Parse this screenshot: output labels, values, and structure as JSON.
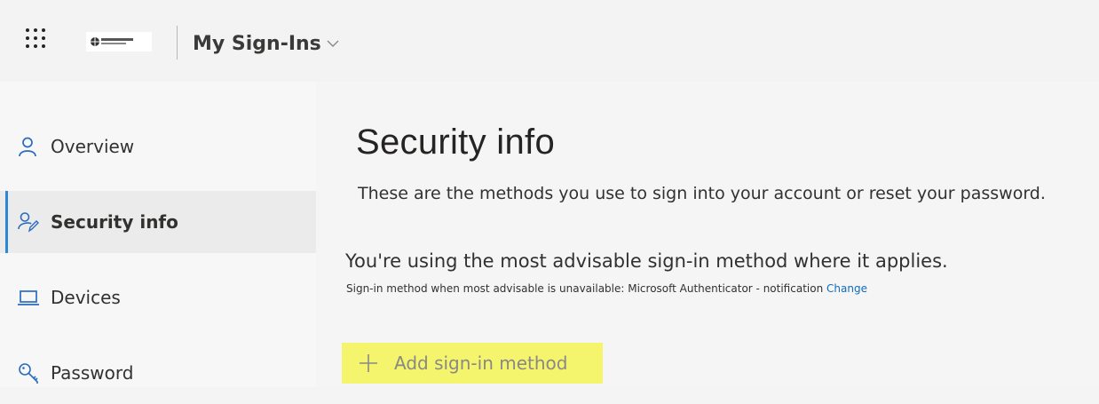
{
  "header": {
    "app_title": "My Sign-Ins",
    "waffle_icon": "waffle-grid-icon",
    "dropdown_icon": "chevron-down-icon"
  },
  "sidebar": {
    "items": [
      {
        "label": "Overview",
        "icon": "person-icon",
        "active": false
      },
      {
        "label": "Security info",
        "icon": "security-info-icon",
        "active": true
      },
      {
        "label": "Devices",
        "icon": "laptop-icon",
        "active": false
      },
      {
        "label": "Password",
        "icon": "key-icon",
        "active": false
      }
    ]
  },
  "main": {
    "title": "Security info",
    "subtitle": "These are the methods you use to sign into your account or reset your password.",
    "advisable_heading": "You're using the most advisable sign-in method where it applies.",
    "advisable_note": "Sign-in method when most advisable is unavailable: Microsoft Authenticator - notification",
    "change_link": "Change",
    "add_method_label": "Add sign-in method",
    "add_method_icon": "plus-icon",
    "highlight_color": "#f4f56c"
  },
  "colors": {
    "accent": "#2b88d8",
    "link": "#0f6cbd"
  }
}
